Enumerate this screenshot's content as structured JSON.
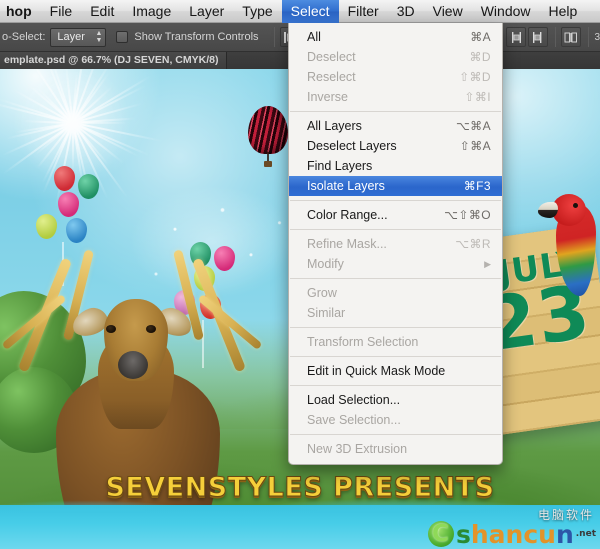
{
  "menubar": {
    "items": [
      {
        "label": "hop",
        "active": false,
        "bold": true
      },
      {
        "label": "File",
        "active": false
      },
      {
        "label": "Edit",
        "active": false
      },
      {
        "label": "Image",
        "active": false
      },
      {
        "label": "Layer",
        "active": false
      },
      {
        "label": "Type",
        "active": false
      },
      {
        "label": "Select",
        "active": true
      },
      {
        "label": "Filter",
        "active": false
      },
      {
        "label": "3D",
        "active": false
      },
      {
        "label": "View",
        "active": false
      },
      {
        "label": "Window",
        "active": false
      },
      {
        "label": "Help",
        "active": false
      }
    ]
  },
  "options_bar": {
    "auto_select_label": "o-Select:",
    "auto_select_value": "Layer",
    "show_transform_controls_label": "Show Transform Controls",
    "show_transform_controls_checked": false
  },
  "app_title": "toshop CC",
  "document_tab": {
    "title": "emplate.psd @ 66.7% (DJ SEVEN, CMYK/8)"
  },
  "select_menu": {
    "title": "Select",
    "items": [
      {
        "label": "All",
        "shortcut": "⌘A",
        "disabled": false,
        "selected": false,
        "submenu": false
      },
      {
        "label": "Deselect",
        "shortcut": "⌘D",
        "disabled": true,
        "selected": false,
        "submenu": false
      },
      {
        "label": "Reselect",
        "shortcut": "⇧⌘D",
        "disabled": true,
        "selected": false,
        "submenu": false
      },
      {
        "label": "Inverse",
        "shortcut": "⇧⌘I",
        "disabled": true,
        "selected": false,
        "submenu": false
      },
      {
        "separator": true
      },
      {
        "label": "All Layers",
        "shortcut": "⌥⌘A",
        "disabled": false,
        "selected": false,
        "submenu": false
      },
      {
        "label": "Deselect Layers",
        "shortcut": "⇧⌘A",
        "disabled": false,
        "selected": false,
        "submenu": false
      },
      {
        "label": "Find Layers",
        "shortcut": "",
        "disabled": false,
        "selected": false,
        "submenu": false
      },
      {
        "label": "Isolate Layers",
        "shortcut": "⌘F3",
        "disabled": false,
        "selected": true,
        "submenu": false
      },
      {
        "separator": true
      },
      {
        "label": "Color Range...",
        "shortcut": "⌥⇧⌘O",
        "disabled": false,
        "selected": false,
        "submenu": false
      },
      {
        "separator": true
      },
      {
        "label": "Refine Mask...",
        "shortcut": "⌥⌘R",
        "disabled": true,
        "selected": false,
        "submenu": false
      },
      {
        "label": "Modify",
        "shortcut": "",
        "disabled": true,
        "selected": false,
        "submenu": true
      },
      {
        "separator": true
      },
      {
        "label": "Grow",
        "shortcut": "",
        "disabled": true,
        "selected": false,
        "submenu": false
      },
      {
        "label": "Similar",
        "shortcut": "",
        "disabled": true,
        "selected": false,
        "submenu": false
      },
      {
        "separator": true
      },
      {
        "label": "Transform Selection",
        "shortcut": "",
        "disabled": true,
        "selected": false,
        "submenu": false
      },
      {
        "separator": true
      },
      {
        "label": "Edit in Quick Mask Mode",
        "shortcut": "",
        "disabled": false,
        "selected": false,
        "submenu": false
      },
      {
        "separator": true
      },
      {
        "label": "Load Selection...",
        "shortcut": "",
        "disabled": false,
        "selected": false,
        "submenu": false
      },
      {
        "label": "Save Selection...",
        "shortcut": "",
        "disabled": true,
        "selected": false,
        "submenu": false
      },
      {
        "separator": true
      },
      {
        "label": "New 3D Extrusion",
        "shortcut": "",
        "disabled": true,
        "selected": false,
        "submenu": false
      }
    ]
  },
  "artwork": {
    "hero_text": "SEVENSTYLES PRESENTS",
    "sign_month": "JULY",
    "sign_day": "23",
    "sky_color": "#7ccfe6",
    "hero_text_color": "#f5cf3a",
    "sign_text_color": "#0f8a57"
  },
  "watermark": {
    "brand": "shancun",
    "brand_part_a": "s",
    "brand_part_b": "hancu",
    "brand_part_c": "n",
    "domain": ".net",
    "chinese_text": "电脑软件"
  }
}
